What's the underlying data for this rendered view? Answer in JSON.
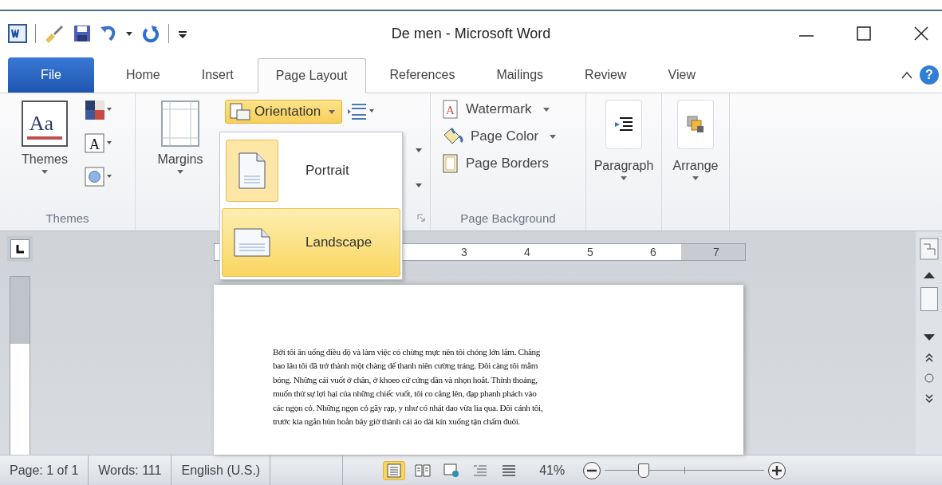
{
  "title_bar": {
    "title": "De men - Microsoft Word"
  },
  "tabs": [
    {
      "label": "File",
      "kind": "file",
      "selected": false
    },
    {
      "label": "Home",
      "kind": "tab",
      "selected": false
    },
    {
      "label": "Insert",
      "kind": "tab",
      "selected": false
    },
    {
      "label": "Page Layout",
      "kind": "tab",
      "selected": true
    },
    {
      "label": "References",
      "kind": "tab",
      "selected": false
    },
    {
      "label": "Mailings",
      "kind": "tab",
      "selected": false
    },
    {
      "label": "Review",
      "kind": "tab",
      "selected": false
    },
    {
      "label": "View",
      "kind": "tab",
      "selected": false
    }
  ],
  "help_button": "?",
  "themes_group": {
    "button": "Themes",
    "label": "Themes",
    "icon_text": "Aa",
    "fonts_icon_text": "A"
  },
  "page_setup_group": {
    "margins": "Margins",
    "orientation": "Orientation"
  },
  "orientation_menu": [
    {
      "label": "Portrait",
      "kind": "portrait",
      "current": true,
      "selected": false
    },
    {
      "label": "Landscape",
      "kind": "landscape",
      "current": false,
      "selected": true
    }
  ],
  "page_background_group": {
    "label": "Page Background",
    "buttons": [
      {
        "label": "Watermark",
        "kind": "watermark",
        "icon_text": "A",
        "dropdown": true
      },
      {
        "label": "Page Color",
        "kind": "page-color",
        "dropdown": true
      },
      {
        "label": "Page Borders",
        "kind": "page-borders",
        "dropdown": false
      }
    ]
  },
  "paragraph_button": "Paragraph",
  "arrange_button": "Arrange",
  "ruler": {
    "numbers": [
      "3",
      "4",
      "5",
      "6",
      "7"
    ]
  },
  "document": {
    "lines": [
      "Bởi tôi ăn uống điều độ và làm việc có chừng mực nên tôi chóng lớn lắm. Chẳng",
      "bao lâu tôi đã trở thành một chàng dế thanh niên cường tráng. Đôi càng tôi mẫm",
      "bóng. Những cái vuốt ở chân, ở khoeo cứ cứng dần và nhọn hoắt. Thỉnh thoảng,",
      "muốn thử sự lợi hại của những chiếc vuốt, tôi co cẳng lên, đạp phanh phách vào",
      "các ngọn cỏ. Những ngọn cỏ gãy rạp, y như có nhát dao vừa lia qua. Đôi cánh tôi,",
      "trước kia ngắn hủn hoẳn bây giờ thành cái áo dài kín xuống tận chấm đuôi."
    ]
  },
  "status_bar": {
    "page": "Page: 1 of 1",
    "words": "Words: 111",
    "language": "English (U.S.)",
    "views": [
      {
        "kind": "print",
        "selected": true
      },
      {
        "kind": "reading",
        "selected": false
      },
      {
        "kind": "web",
        "selected": false
      },
      {
        "kind": "outline",
        "selected": false
      },
      {
        "kind": "draft",
        "selected": false
      }
    ],
    "zoom": "41%",
    "zoom_slider": {
      "level": 0.24
    }
  }
}
